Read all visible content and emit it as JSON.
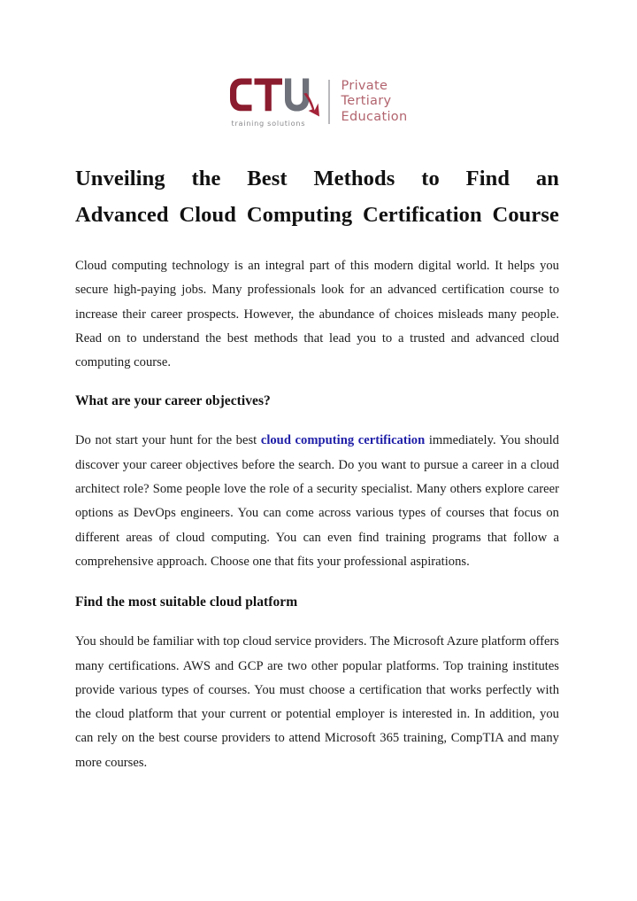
{
  "logo": {
    "brand_letters": "CTU",
    "tagline": "training solutions",
    "descriptor_line1": "Private",
    "descriptor_line2": "Tertiary",
    "descriptor_line3": "Education",
    "brand_color": "#8b1b2e",
    "accent_color": "#a42338",
    "letter_u_color": "#6e717a",
    "tagline_color": "#8a8a8e",
    "descriptor_color": "#b2646e",
    "divider_color": "#b9b9bd"
  },
  "article": {
    "title_line_1": "Unveiling the Best Methods to Find an",
    "title_line_2": "Advanced Cloud Computing Certification Course",
    "paragraph_1": "Cloud computing technology is an integral part of this modern digital world. It helps you secure high-paying jobs. Many professionals look for an advanced certification course to increase their career prospects. However, the abundance of choices misleads many people. Read on to understand the best methods that lead you to a trusted and advanced cloud computing course.",
    "heading_1": "What are your career objectives?",
    "paragraph_2_before_link": "Do not start your hunt for the best ",
    "paragraph_2_link": "cloud computing certification",
    "paragraph_2_after_link": " immediately. You should discover your career objectives before the search. Do you want to pursue a career in a cloud architect role? Some people love the role of a security specialist. Many others explore career options as DevOps engineers. You can come across various types of courses that focus on different areas of cloud computing. You can even find training programs that follow a comprehensive approach. Choose one that fits your professional aspirations.",
    "heading_2": "Find the most suitable cloud platform",
    "paragraph_3": "You should be familiar with top cloud service providers. The Microsoft Azure platform offers many certifications. AWS and GCP are two other popular platforms. Top training institutes provide various types of courses. You must choose a certification that works perfectly with the cloud platform that your current or potential employer is interested in. In addition, you can rely on the best course providers to attend Microsoft 365 training, CompTIA and many more courses.",
    "link_color": "#1e1ea8",
    "text_color": "#1b1b1b"
  }
}
